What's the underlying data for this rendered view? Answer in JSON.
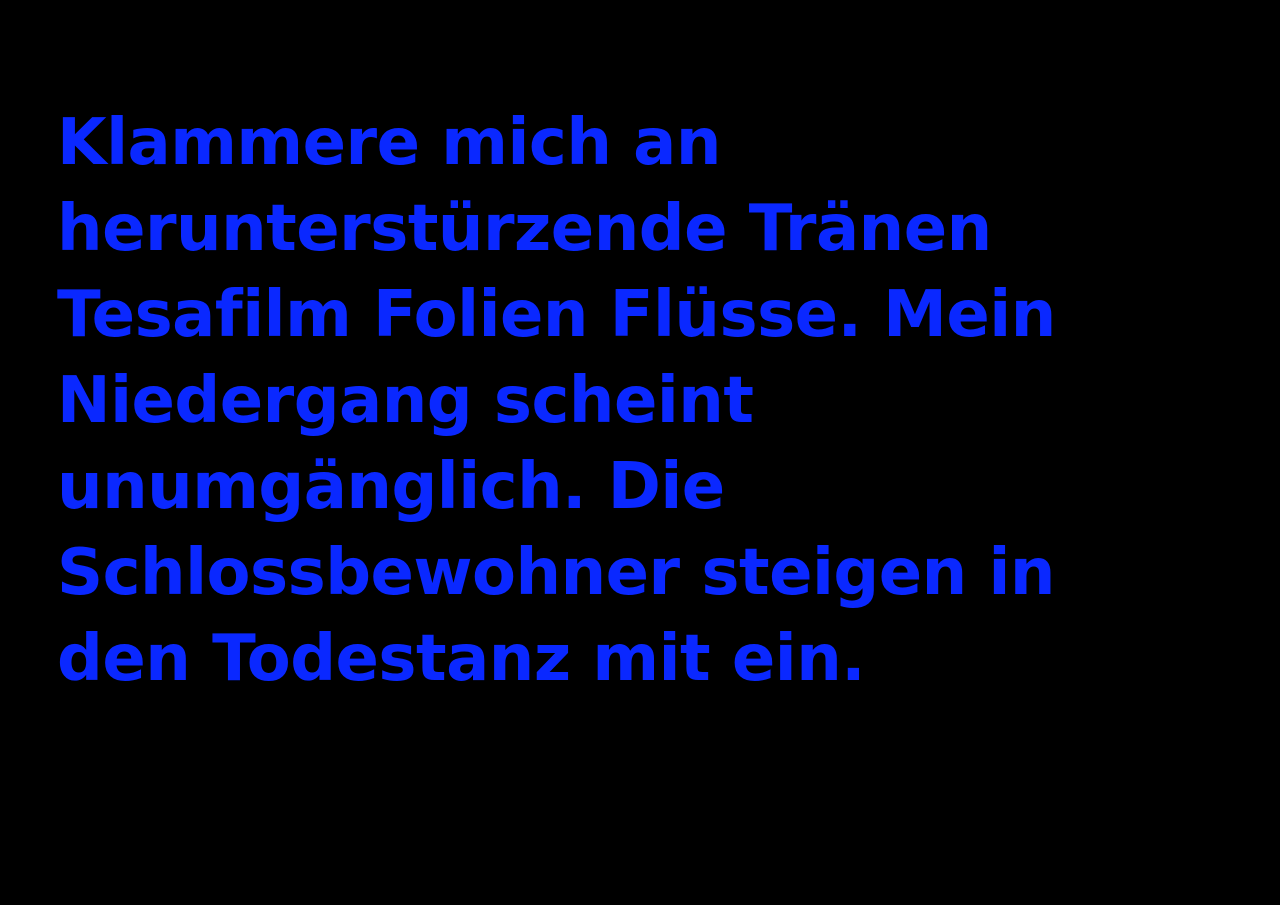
{
  "text_color": "#0a28ff",
  "background_color": "#000000",
  "lines": [
    "Klammere mich an",
    "herunterstürzende Tränen",
    "Tesafilm Folien Flüsse. Mein",
    "Niedergang scheint",
    "unumgänglich. Die",
    "Schlossbewohner steigen in",
    "den Todestanz mit ein."
  ]
}
